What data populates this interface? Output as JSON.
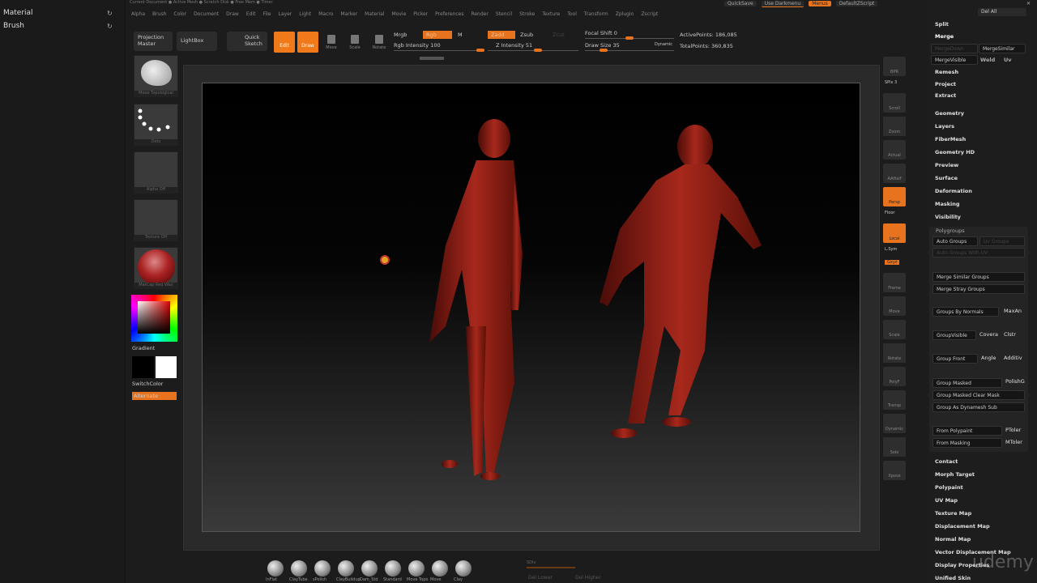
{
  "left_panel": {
    "items": [
      {
        "label": "Material"
      },
      {
        "label": "Brush"
      }
    ]
  },
  "titlebar": "Current Document  ●  Active Mesh  ●  Scratch Disk  ●  Free Mem  ●  Timer",
  "menu": [
    "Alpha",
    "Brush",
    "Color",
    "Document",
    "Draw",
    "Edit",
    "File",
    "Layer",
    "Light",
    "Macro",
    "Marker",
    "Material",
    "Movie",
    "Picker",
    "Preferences",
    "Render",
    "Stencil",
    "Stroke",
    "Texture",
    "Tool",
    "Transform",
    "Zplugin",
    "Zscript"
  ],
  "top_right": {
    "quicksave": "QuickSave",
    "layout": "Use Darkmenu",
    "menus": "Menus",
    "script": "DefaultZScript",
    "del_all": "Del All"
  },
  "toolbar": {
    "projection_master": "Projection Master",
    "lightbox": "LightBox",
    "quick_sketch": "Quick Sketch",
    "edit": "Edit",
    "draw": "Draw",
    "move": "Move",
    "scale": "Scale",
    "rotate": "Rotate",
    "mrgb": "Mrgb",
    "rgb": "Rgb",
    "m": "M",
    "rgb_intensity": "Rgb Intensity 100",
    "zadd": "Zadd",
    "zsub": "Zsub",
    "zcut": "Zcut",
    "z_intensity": "Z Intensity 51",
    "focal_shift": "Focal Shift 0",
    "draw_size": "Draw Size 35",
    "dynamic": "Dynamic",
    "active_points": "ActivePoints: 186,085",
    "total_points": "TotalPoints: 360,835"
  },
  "sliders": {
    "rgb_intensity": 100,
    "z_intensity": 51,
    "focal_shift": 0,
    "draw_size": 35
  },
  "left_shelf": {
    "brush": "Move Topological",
    "stroke": "Dots",
    "alpha": "Alpha Off",
    "texture": "Texture Off",
    "material": "MatCap Red Wax",
    "gradient": "Gradient",
    "switch_color": "SwitchColor",
    "alternate": "Alternate"
  },
  "right_shelf": [
    "BPR",
    "SPix 3",
    "Scroll",
    "Zoom",
    "Actual",
    "AAHalf",
    "Persp",
    "Floor",
    "Local",
    "L.Sym",
    "Gxyz",
    "Frame",
    "Move",
    "Scale",
    "Rotate",
    "PolyF",
    "Transp",
    "Dynamic",
    "Solo",
    "Xpose"
  ],
  "right_panel": {
    "top": [
      "Split",
      "Merge"
    ],
    "merge_down": "MergeDown",
    "merge_similar": "MergeSimilar",
    "merge_visible": "MergeVisible",
    "weld": "Weld",
    "uv": "Uv",
    "after_merge": [
      "Remesh",
      "Project",
      "Extract"
    ],
    "sections": [
      "Geometry",
      "Layers",
      "FiberMesh",
      "Geometry HD",
      "Preview",
      "Surface",
      "Deformation",
      "Masking",
      "Visibility"
    ],
    "polygroups": {
      "title": "Polygroups",
      "auto_groups": "Auto Groups",
      "uv_groups": "Uv Groups",
      "auto_groups_uv": "Auto Groups With UV",
      "merge_similar": "Merge Similar Groups",
      "merge_stray": "Merge Stray Groups",
      "by_normals": "Groups By Normals",
      "maxangle": "MaxAn",
      "group_visible": "GroupVisible",
      "coverage": "Covera",
      "clstr": "Clstr",
      "group_front": "Group Front",
      "angle": "Angle",
      "additive": "Additiv",
      "group_masked": "Group Masked",
      "polish": "PolishG",
      "group_masked_clear": "Group Masked Clear Mask",
      "group_dynamesh": "Group As Dynamesh Sub",
      "from_polypaint": "From Polypaint",
      "ptoler": "PToler",
      "from_masking": "From Masking",
      "mtoler": "MToler"
    },
    "sections_after": [
      "Contact",
      "Morph Target",
      "Polypaint",
      "UV Map",
      "Texture Map",
      "Displacement Map",
      "Normal Map",
      "Vector Displacement Map",
      "Display Properties",
      "Unified Skin"
    ]
  },
  "brushes": [
    "InFlat",
    "ClayTube",
    "sPolish",
    "ClayBuildup",
    "Dam_Std",
    "Standard",
    "Move Topo",
    "Move",
    "Clay"
  ],
  "bottom_right": {
    "size": "SDiv",
    "del_lower": "Del Lower",
    "del_higher": "Del Higher"
  },
  "watermark": "udemy"
}
